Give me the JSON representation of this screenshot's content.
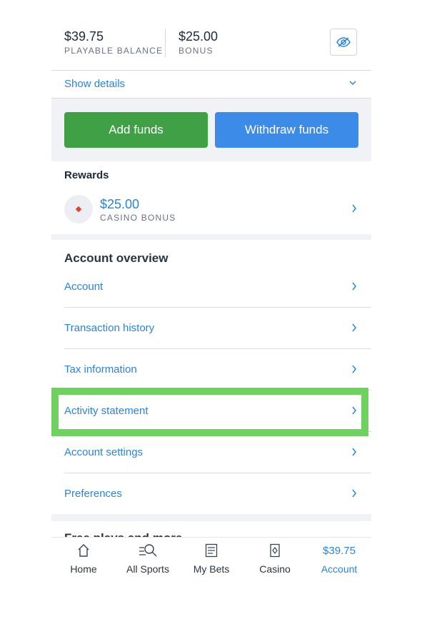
{
  "balance": {
    "playable_amount": "$39.75",
    "playable_label": "PLAYABLE BALANCE",
    "bonus_amount": "$25.00",
    "bonus_label": "BONUS"
  },
  "details": {
    "label": "Show details"
  },
  "funds": {
    "add_label": "Add funds",
    "withdraw_label": "Withdraw funds"
  },
  "rewards": {
    "title": "Rewards",
    "amount": "$25.00",
    "label": "CASINO BONUS"
  },
  "overview": {
    "title": "Account overview",
    "items": [
      {
        "label": "Account"
      },
      {
        "label": "Transaction history"
      },
      {
        "label": "Tax information"
      },
      {
        "label": "Activity statement"
      },
      {
        "label": "Account settings"
      },
      {
        "label": "Preferences"
      }
    ]
  },
  "next_section": {
    "title": "Free plays and more"
  },
  "nav": {
    "home": "Home",
    "sports": "All Sports",
    "bets": "My Bets",
    "casino": "Casino",
    "account_amount": "$39.75",
    "account": "Account"
  },
  "colors": {
    "accent": "#2b84d7",
    "add": "#3fa045",
    "withdraw": "#3d8be8",
    "highlight": "#6fd15f"
  }
}
